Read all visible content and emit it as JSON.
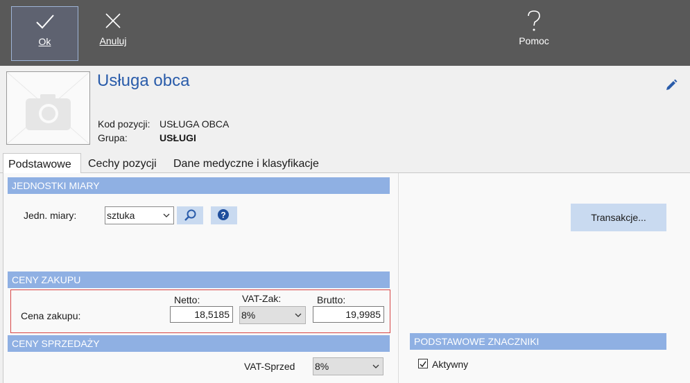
{
  "toolbar": {
    "ok_label": "Ok",
    "cancel_label": "Anuluj",
    "help_label": "Pomoc"
  },
  "header": {
    "title": "Usługa obca",
    "kod_label": "Kod pozycji:",
    "kod_value": "USŁUGA OBCA",
    "grupa_label": "Grupa:",
    "grupa_value": "USŁUGI"
  },
  "tabs": [
    {
      "label": "Podstawowe",
      "active": true
    },
    {
      "label": "Cechy pozycji",
      "active": false
    },
    {
      "label": "Dane medyczne i klasyfikacje",
      "active": false
    }
  ],
  "jednostki": {
    "section_title": "JEDNOSTKI MIARY",
    "label": "Jedn. miary:",
    "value": "sztuka"
  },
  "ceny_zakupu": {
    "section_title": "CENY ZAKUPU",
    "label": "Cena zakupu:",
    "netto_label": "Netto:",
    "netto_value": "18,5185",
    "vat_label": "VAT-Zak:",
    "vat_value": "8%",
    "brutto_label": "Brutto:",
    "brutto_value": "19,9985"
  },
  "ceny_sprzedazy": {
    "section_title": "CENY SPRZEDAŻY",
    "vat_label": "VAT-Sprzed",
    "vat_value": "8%"
  },
  "right_panel": {
    "transakcje_label": "Transakcje...",
    "znaczniki_title": "PODSTAWOWE ZNACZNIKI",
    "aktywny_label": "Aktywny",
    "aktywny_checked": true
  },
  "colors": {
    "toolbar_bg": "#595959",
    "section_bg": "#8fb0e3",
    "title_color": "#2a5caa",
    "button_bg": "#c9daf0",
    "highlight_border": "#d64545"
  }
}
